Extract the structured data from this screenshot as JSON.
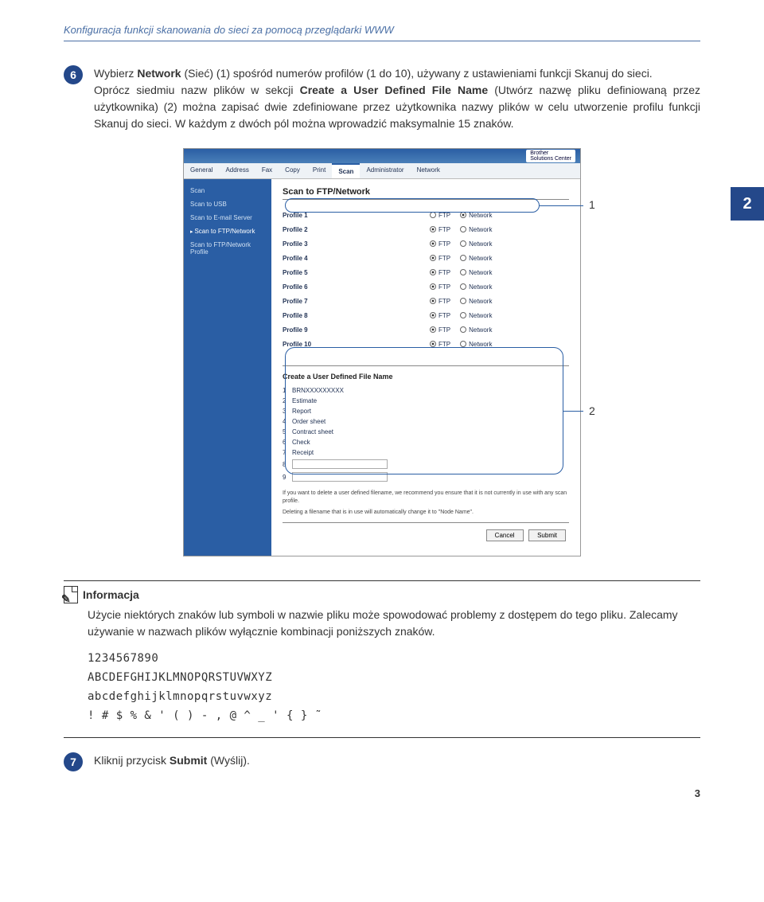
{
  "header": "Konfiguracja funkcji skanowania do sieci za pomocą przeglądarki WWW",
  "sideTab": "2",
  "step6": {
    "num": "6",
    "line1_a": "Wybierz ",
    "line1_b": "Network",
    "line1_c": " (Sieć) (1) spośród numerów profilów (1 do 10), używany z ustawieniami funkcji Skanuj do sieci.",
    "line2_a": "Oprócz siedmiu nazw plików w sekcji ",
    "line2_b": "Create a User Defined File Name",
    "line2_c": " (Utwórz nazwę pliku definiowaną przez użytkownika) (2) można zapisać dwie zdefiniowane przez użytkownika nazwy plików w celu utworzenie profilu funkcji Skanuj do sieci. W każdym z dwóch pól można wprowadzić maksymalnie 15 znaków."
  },
  "app": {
    "brother": {
      "l1": "Brother",
      "l2": "Solutions Center"
    },
    "tabs": [
      "General",
      "Address",
      "Fax",
      "Copy",
      "Print",
      "Scan",
      "Administrator",
      "Network"
    ],
    "activeTab": 5,
    "sidebar": [
      "Scan",
      "Scan to USB",
      "Scan to E-mail Server",
      "Scan to FTP/Network",
      "Scan to FTP/Network Profile"
    ],
    "sidebarActive": 3,
    "mainTitle": "Scan to FTP/Network",
    "profiles": [
      "Profile 1",
      "Profile 2",
      "Profile 3",
      "Profile 4",
      "Profile 5",
      "Profile 6",
      "Profile 7",
      "Profile 8",
      "Profile 9",
      "Profile 10"
    ],
    "ftp": "FTP",
    "net": "Network",
    "sec2Title": "Create a User Defined File Name",
    "fnames": [
      "BRNXXXXXXXXX",
      "Estimate",
      "Report",
      "Order sheet",
      "Contract sheet",
      "Check",
      "Receipt",
      "",
      ""
    ],
    "note1": "If you want to delete a user defined filename, we recommend you ensure that it is not currently in use with any scan profile.",
    "note2": "Deleting a filename that is in use will automatically change it to \"Node Name\".",
    "cancel": "Cancel",
    "submit": "Submit"
  },
  "callouts": {
    "c1": "1",
    "c2": "2"
  },
  "info": {
    "title": "Informacja",
    "body": "Użycie niektórych znaków lub symboli w nazwie pliku może spowodować problemy z dostępem do tego pliku. Zalecamy używanie w nazwach plików wyłącznie kombinacji poniższych znaków.",
    "l1": "1234567890",
    "l2": "ABCDEFGHIJKLMNOPQRSTUVWXYZ",
    "l3": "abcdefghijklmnopqrstuvwxyz",
    "l4": "! # $ % & ' ( ) - , @ ^ _ ' { } ˜"
  },
  "step7": {
    "num": "7",
    "a": "Kliknij przycisk ",
    "b": "Submit",
    "c": " (Wyślij)."
  },
  "pageNum": "3"
}
